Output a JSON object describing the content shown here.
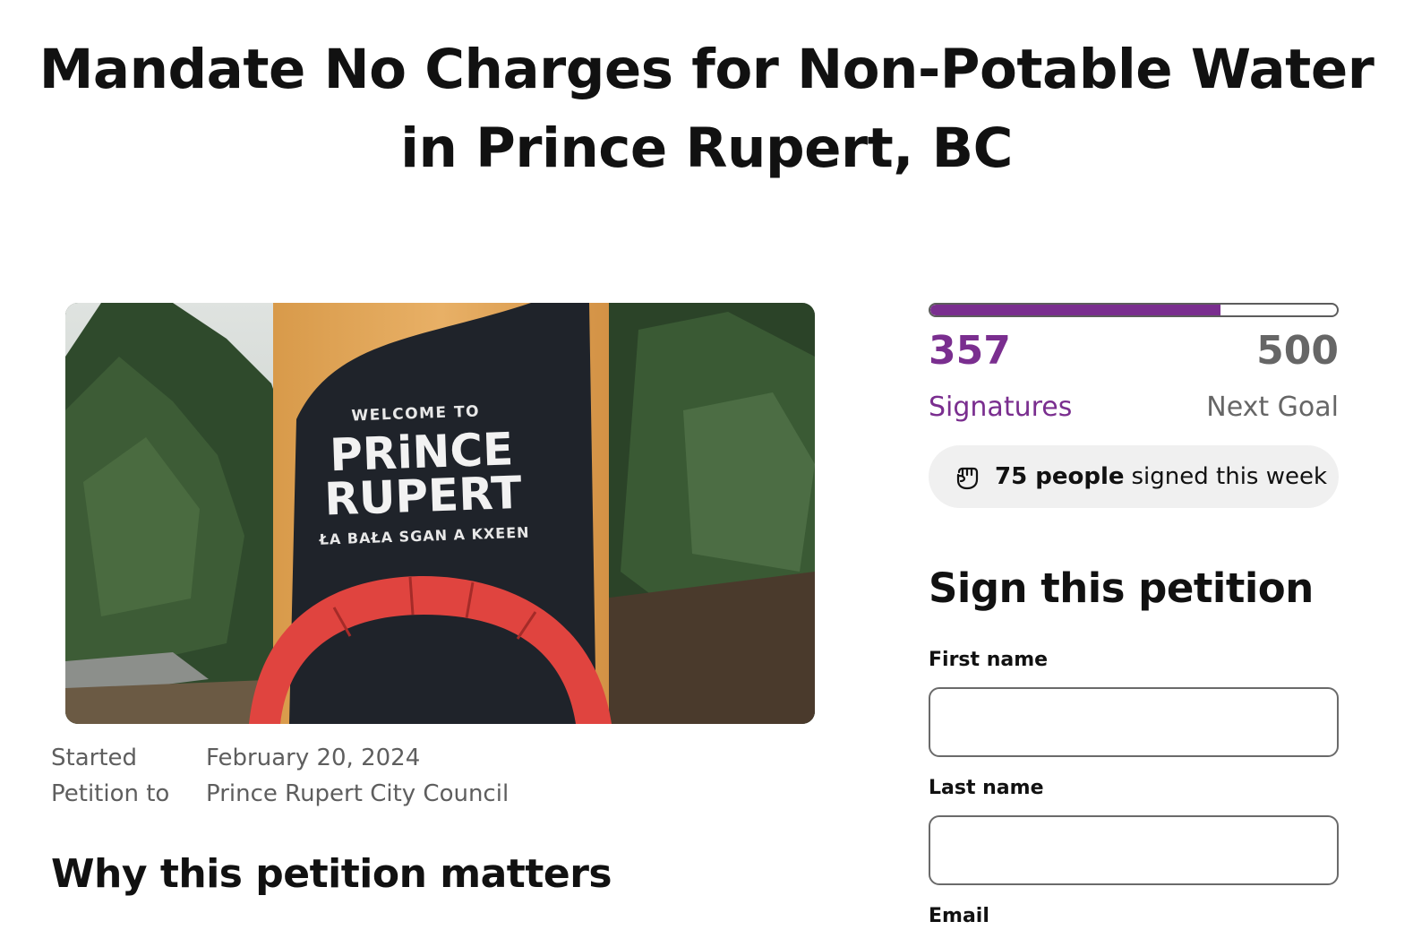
{
  "petition": {
    "title_line1": "Mandate No Charges for Non-Potable Water",
    "title_line2": "in Prince Rupert, BC",
    "image_sign": {
      "welcome": "WELCOME TO",
      "line1": "PRiNCE",
      "line2": "RUPERT",
      "subtitle": "ŁA BAŁA SGAN A KXEEN"
    },
    "meta": {
      "started_label": "Started",
      "started_value": "February 20, 2024",
      "petition_to_label": "Petition to",
      "petition_to_value": "Prince Rupert City Council"
    },
    "why_heading": "Why this petition matters"
  },
  "signatures": {
    "count": "357",
    "goal": "500",
    "progress_fraction": 0.714,
    "count_label": "Signatures",
    "goal_label": "Next Goal",
    "week_count": "75 people",
    "week_text": "signed this week",
    "week_icon": "fist-icon",
    "accent_color": "#7a2e8f"
  },
  "sign_form": {
    "heading": "Sign this petition",
    "first_name_label": "First name",
    "first_name_value": "",
    "last_name_label": "Last name",
    "last_name_value": "",
    "email_label": "Email"
  }
}
